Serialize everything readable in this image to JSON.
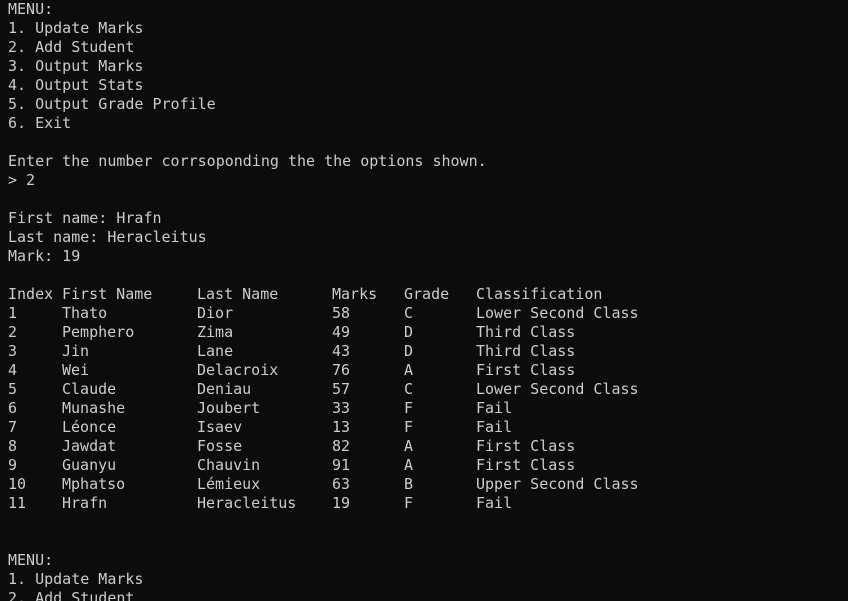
{
  "menu_first": {
    "header": "MENU:",
    "items": [
      "1. Update Marks",
      "2. Add Student",
      "3. Output Marks",
      "4. Output Stats",
      "5. Output Grade Profile",
      "6. Exit"
    ]
  },
  "prompt": {
    "instruction": "Enter the number corrsoponding the the options shown.",
    "input_line": "> 2"
  },
  "new_student": {
    "first_name_line": "First name: Hrafn",
    "last_name_line": "Last name: Heracleitus",
    "mark_line": "Mark: 19"
  },
  "table": {
    "headers": [
      "Index",
      "First Name",
      "Last Name",
      "Marks",
      "Grade",
      "Classification"
    ],
    "rows": [
      [
        "1",
        "Thato",
        "Dior",
        "58",
        "C",
        "Lower Second Class"
      ],
      [
        "2",
        "Pemphero",
        "Zima",
        "49",
        "D",
        "Third Class"
      ],
      [
        "3",
        "Jin",
        "Lane",
        "43",
        "D",
        "Third Class"
      ],
      [
        "4",
        "Wei",
        "Delacroix",
        "76",
        "A",
        "First Class"
      ],
      [
        "5",
        "Claude",
        "Deniau",
        "57",
        "C",
        "Lower Second Class"
      ],
      [
        "6",
        "Munashe",
        "Joubert",
        "33",
        "F",
        "Fail"
      ],
      [
        "7",
        "Léonce",
        "Isaev",
        "13",
        "F",
        "Fail"
      ],
      [
        "8",
        "Jawdat",
        "Fosse",
        "82",
        "A",
        "First Class"
      ],
      [
        "9",
        "Guanyu",
        "Chauvin",
        "91",
        "A",
        "First Class"
      ],
      [
        "10",
        "Mphatso",
        "Lémieux",
        "63",
        "B",
        "Upper Second Class"
      ],
      [
        "11",
        "Hrafn",
        "Heracleitus",
        "19",
        "F",
        "Fail"
      ]
    ]
  },
  "menu_second": {
    "header": "MENU:",
    "items": [
      "1. Update Marks",
      "2. Add Student"
    ]
  },
  "colors": {
    "background": "#0c0c0c",
    "text": "#cccccc"
  }
}
